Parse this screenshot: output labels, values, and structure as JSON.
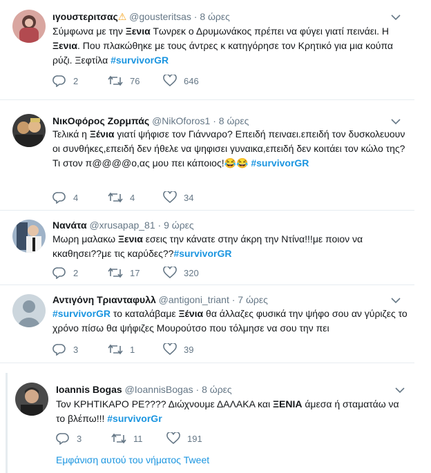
{
  "tweets": [
    {
      "name": "ιγουστεριτσας",
      "name_emoji": "⚠",
      "handle": "@gousteritsas",
      "time": "8 ώρες",
      "text_segments": [
        {
          "t": "Σύμφωνα με την ",
          "s": "plain"
        },
        {
          "t": "Ξενια",
          "s": "kw"
        },
        {
          "t": " Τωνρεκ ο Δρυμωνάκος πρέπει να φύγει γιατί πεινάει. Η ",
          "s": "plain"
        },
        {
          "t": "Ξενια",
          "s": "kw"
        },
        {
          "t": ". Που πλακώθηκε με τους άντρες κ κατηγόρησε τον Κρητικό για μια κούπα ρύζι.  Ξεφτίλα ",
          "s": "plain"
        },
        {
          "t": "#survivorGR",
          "s": "hl"
        }
      ],
      "replies": "2",
      "retweets": "76",
      "likes": "646"
    },
    {
      "name": "ΝικΟφόρος Ζορμπάς",
      "handle": "@NikOforos1",
      "time": "8 ώρες",
      "text_segments": [
        {
          "t": "Τελικά η ",
          "s": "plain"
        },
        {
          "t": "Ξένια",
          "s": "kw"
        },
        {
          "t": " γιατί ψήφισε τον Γιάνναρο? Επειδή πειναει.επειδή τον δυσκολευουν οι συνθήκες,επειδή δεν ήθελε να ψηφισει γυναικα,επειδή δεν κοιτάει τον κώλο της? Τι στον π@@@@ο,ας μου πει κάποιος!😂😂 ",
          "s": "plain"
        },
        {
          "t": "#survivorGR",
          "s": "hl"
        }
      ],
      "replies": "4",
      "retweets": "4",
      "likes": "34"
    },
    {
      "name": "Ναvάτα",
      "handle": "@xrusapap_81",
      "time": "9 ώρες",
      "text_segments": [
        {
          "t": "Μωρη μαλακω ",
          "s": "plain"
        },
        {
          "t": "Ξενια",
          "s": "kw"
        },
        {
          "t": " εσεις την κάνατε στην άκρη την Ντίνα!!!με ποιον να κκαθησει??με τις καρύδες??",
          "s": "plain"
        },
        {
          "t": "#survivorGR",
          "s": "hl"
        }
      ],
      "replies": "2",
      "retweets": "17",
      "likes": "320"
    },
    {
      "name": "Αντιγόνη Τριανταφυλλ",
      "handle": "@antigoni_triant",
      "time": "7 ώρες",
      "text_segments": [
        {
          "t": "#survivorGR",
          "s": "hl"
        },
        {
          "t": " το καταλάβαμε ",
          "s": "plain"
        },
        {
          "t": "Ξένια",
          "s": "kw"
        },
        {
          "t": " θα άλλαζες φυσικά την ψήφο σου αν γύριζες το χρόνο πίσω  θα ψήφιζες  Μουρούτσο που τόλμησε να σου την πει",
          "s": "plain"
        }
      ],
      "replies": "3",
      "retweets": "1",
      "likes": "39"
    },
    {
      "name": "Ioannis Bogas",
      "handle": "@IoannisBogas",
      "time": "8 ώρες",
      "text_segments": [
        {
          "t": "Τον ΚΡΗΤΙΚΑΡΟ ΡΕ???? Διώχνουμε ΔΑΛΑΚΑ και ",
          "s": "plain"
        },
        {
          "t": "ΞΕΝΙΑ",
          "s": "kw"
        },
        {
          "t": " άμεσα ή σταματάω να το βλέπω!!! ",
          "s": "plain"
        },
        {
          "t": "#survivorGr",
          "s": "hl"
        }
      ],
      "replies": "3",
      "retweets": "11",
      "likes": "191"
    }
  ],
  "show_thread": "Εμφάνιση αυτού του νήματος Tweet",
  "colors": {
    "link": "#1b95e0",
    "muted": "#657786",
    "border": "#e6ecf0",
    "text": "#14171a"
  },
  "icons": [
    "reply-icon",
    "retweet-icon",
    "like-icon",
    "chevron-down-icon",
    "warning-emoji"
  ]
}
